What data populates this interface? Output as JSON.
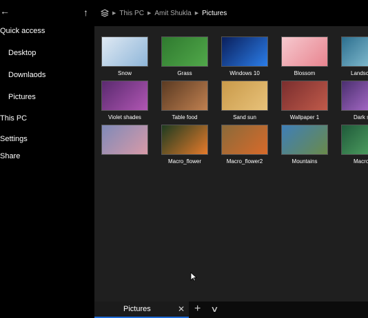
{
  "nav": {
    "back_icon": "←",
    "up_icon": "↑"
  },
  "sidebar": {
    "items": [
      {
        "label": "Quick access"
      },
      {
        "label": "Desktop"
      },
      {
        "label": "Downlaods"
      },
      {
        "label": "Pictures"
      },
      {
        "label": "This PC"
      },
      {
        "label": "Settings"
      },
      {
        "label": "Share"
      }
    ]
  },
  "breadcrumb": {
    "separator": "▶",
    "items": [
      "This PC",
      "Amit Shukla",
      "Pictures"
    ]
  },
  "gallery": {
    "items": [
      {
        "name": "Snow",
        "colors": [
          "#dfe9f3",
          "#8fb6d9"
        ]
      },
      {
        "name": "Grass",
        "colors": [
          "#2f7a2f",
          "#51a84a"
        ]
      },
      {
        "name": "Windows 10",
        "colors": [
          "#0a1f5c",
          "#2b7de8"
        ]
      },
      {
        "name": "Blossom",
        "colors": [
          "#f6c9cf",
          "#e8848f"
        ]
      },
      {
        "name": "Landsc",
        "colors": [
          "#2c6f8f",
          "#9ad0e0"
        ]
      },
      {
        "name": "Violet shades",
        "colors": [
          "#5a2a6f",
          "#b056b3"
        ]
      },
      {
        "name": "Table food",
        "colors": [
          "#5a3a22",
          "#c08050"
        ]
      },
      {
        "name": "Sand sun",
        "colors": [
          "#c99a4a",
          "#e8c27a"
        ]
      },
      {
        "name": "Wallpaper 1",
        "colors": [
          "#7a2e2e",
          "#c05a4a"
        ]
      },
      {
        "name": "Dark s",
        "colors": [
          "#4a2f6f",
          "#c07adf"
        ]
      },
      {
        "name": "",
        "colors": [
          "#7f8ab8",
          "#d89aa8"
        ]
      },
      {
        "name": "Macro_flower",
        "colors": [
          "#1e3b20",
          "#e57a2b"
        ]
      },
      {
        "name": "Macro_flower2",
        "colors": [
          "#8a6a3a",
          "#d86a2a"
        ]
      },
      {
        "name": "Mountains",
        "colors": [
          "#3f7fb8",
          "#6a8a4a"
        ]
      },
      {
        "name": "Macro",
        "colors": [
          "#1f5a3a",
          "#5ab06a"
        ]
      }
    ]
  },
  "tabs": {
    "active_label": "Pictures",
    "close_icon": "✕",
    "add_icon": "+",
    "more_icon": "∨"
  },
  "colors": {
    "accent": "#1e6bd6",
    "pane_bg": "#1f1f1f",
    "sidebar_bg": "#000000"
  }
}
